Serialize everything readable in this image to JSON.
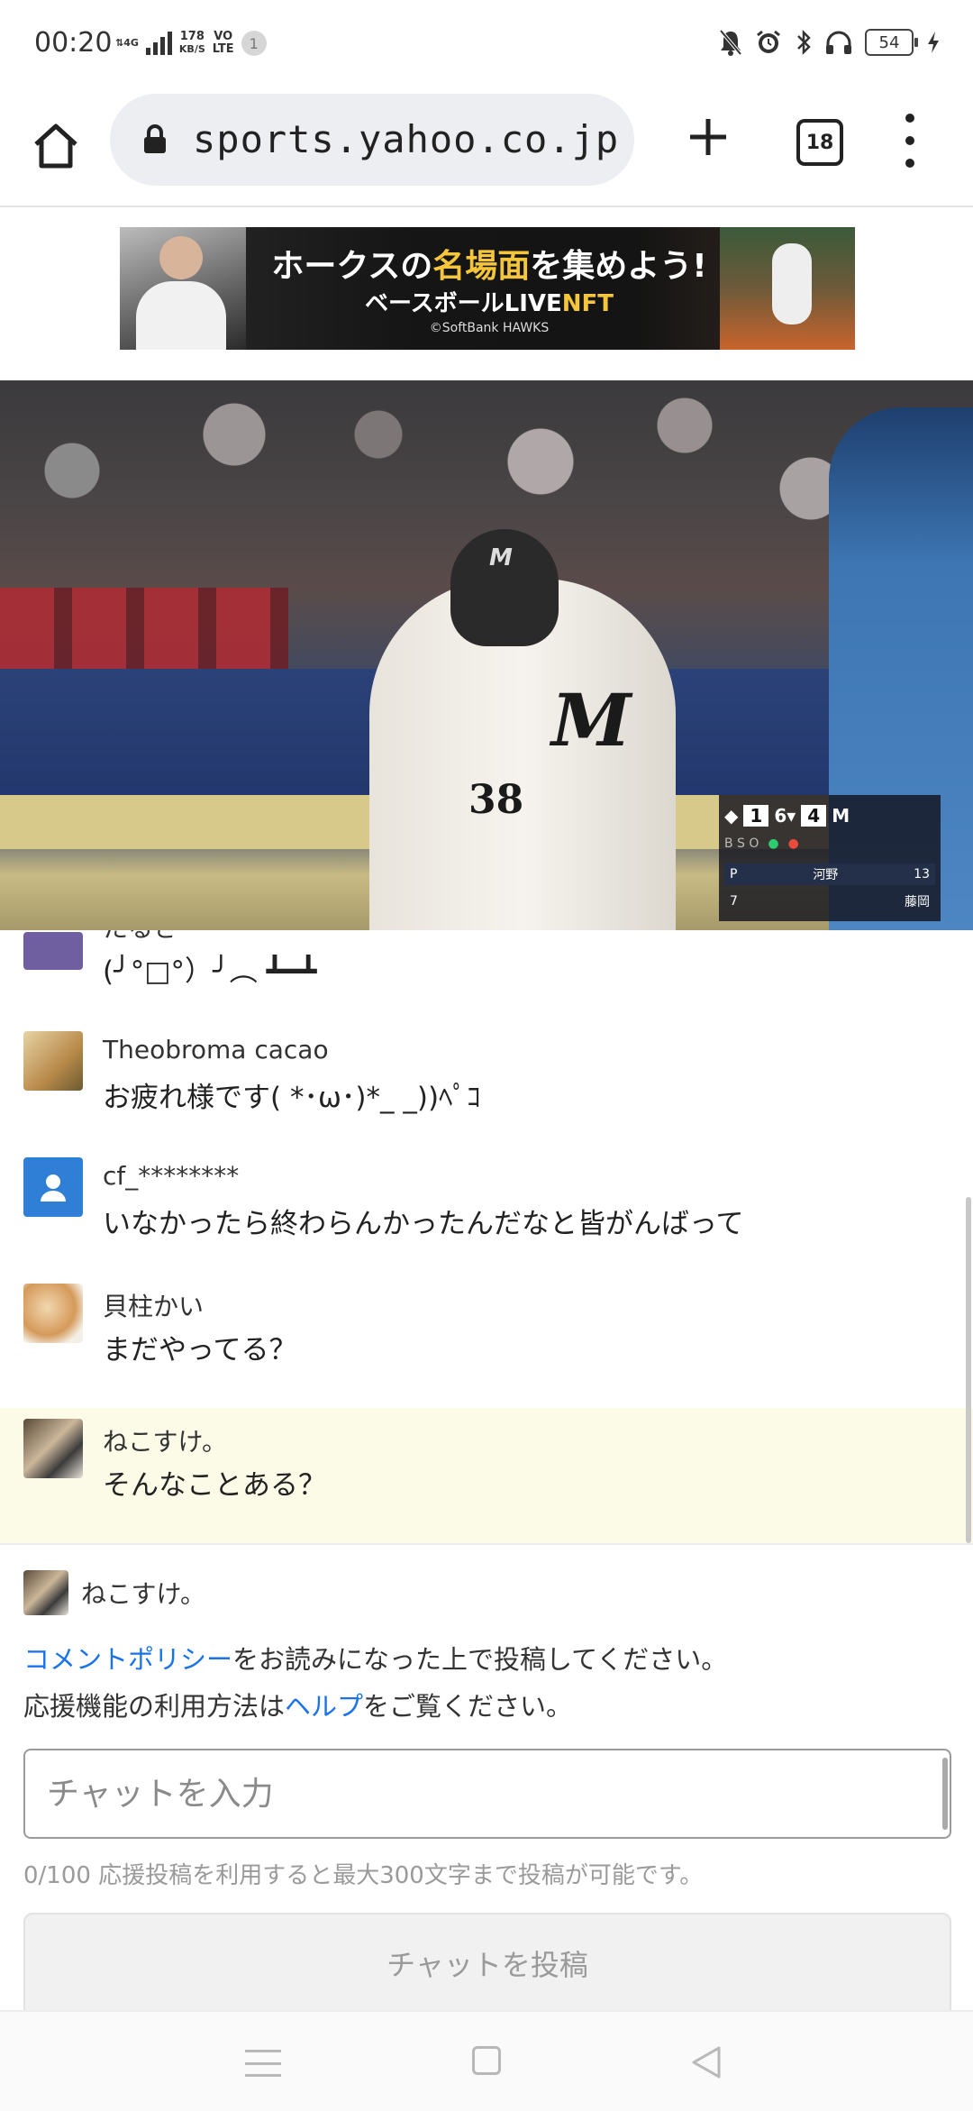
{
  "status_bar": {
    "time": "00:20",
    "network_type": "4G",
    "speed_value": "178",
    "speed_unit": "KB/S",
    "volte_top": "VO",
    "volte_bottom": "LTE",
    "notification_count": "1",
    "battery": "54",
    "icons": [
      "mute-bell-icon",
      "alarm-icon",
      "bluetooth-icon",
      "headphones-icon",
      "battery-icon",
      "charging-icon"
    ]
  },
  "browser": {
    "url": "sports.yahoo.co.jp/live",
    "tab_count": "18",
    "icons": [
      "home-icon",
      "lock-icon",
      "plus-icon",
      "tabs-icon",
      "more-icon"
    ]
  },
  "banner": {
    "title_pre": "ホークスの",
    "title_highlight": "名場面",
    "title_post": "を集めよう!",
    "subtitle": "ベースボールLIVE",
    "subtitle_nft": "NFT",
    "credit": "©SoftBank HAWKS"
  },
  "video": {
    "scoreboard": {
      "away_score": "1",
      "inning": "6",
      "home_score": "4",
      "pitcher_label": "P",
      "pitcher_name": "河野",
      "pitch_count": "13",
      "batter_order": "7",
      "batter_name": "藤岡",
      "bso": "B  S  O"
    },
    "jersey_number": "38",
    "jersey_logo": "M"
  },
  "chat": {
    "messages": [
      {
        "name": "たるさ",
        "text": "(╯°□°）╯︵ ┻━┻",
        "highlighted": false
      },
      {
        "name": "Theobroma cacao",
        "text": "お疲れ様です( *･ω･)*_ _))ﾍﾟｺ",
        "highlighted": false
      },
      {
        "name": "cf_********",
        "text": "いなかったら終わらんかったんだなと皆がんばって",
        "highlighted": false
      },
      {
        "name": "貝柱かい",
        "text": "まだやってる？",
        "highlighted": false
      },
      {
        "name": "ねこすけ。",
        "text": "そんなことある？",
        "highlighted": true
      }
    ]
  },
  "compose": {
    "username": "ねこすけ。",
    "policy_link": "コメントポリシー",
    "policy_text": "をお読みになった上で投稿してください。",
    "help_pre": "応援機能の利用方法は",
    "help_link": "ヘルプ",
    "help_post": "をご覧ください。",
    "input_value": "",
    "input_placeholder": "チャットを入力",
    "counter": "0/100",
    "counter_note": "応援投稿を利用すると最大300文字まで投稿が可能です。",
    "post_button": "チャットを投稿"
  },
  "nav_bar": {
    "icons": [
      "recent-apps-icon",
      "home-square-icon",
      "back-triangle-icon"
    ]
  },
  "colors": {
    "link": "#1a73e8",
    "highlight_row": "#fbfbe8",
    "banner_accent": "#f5c53a",
    "avatar_default": "#2f7fd6"
  }
}
